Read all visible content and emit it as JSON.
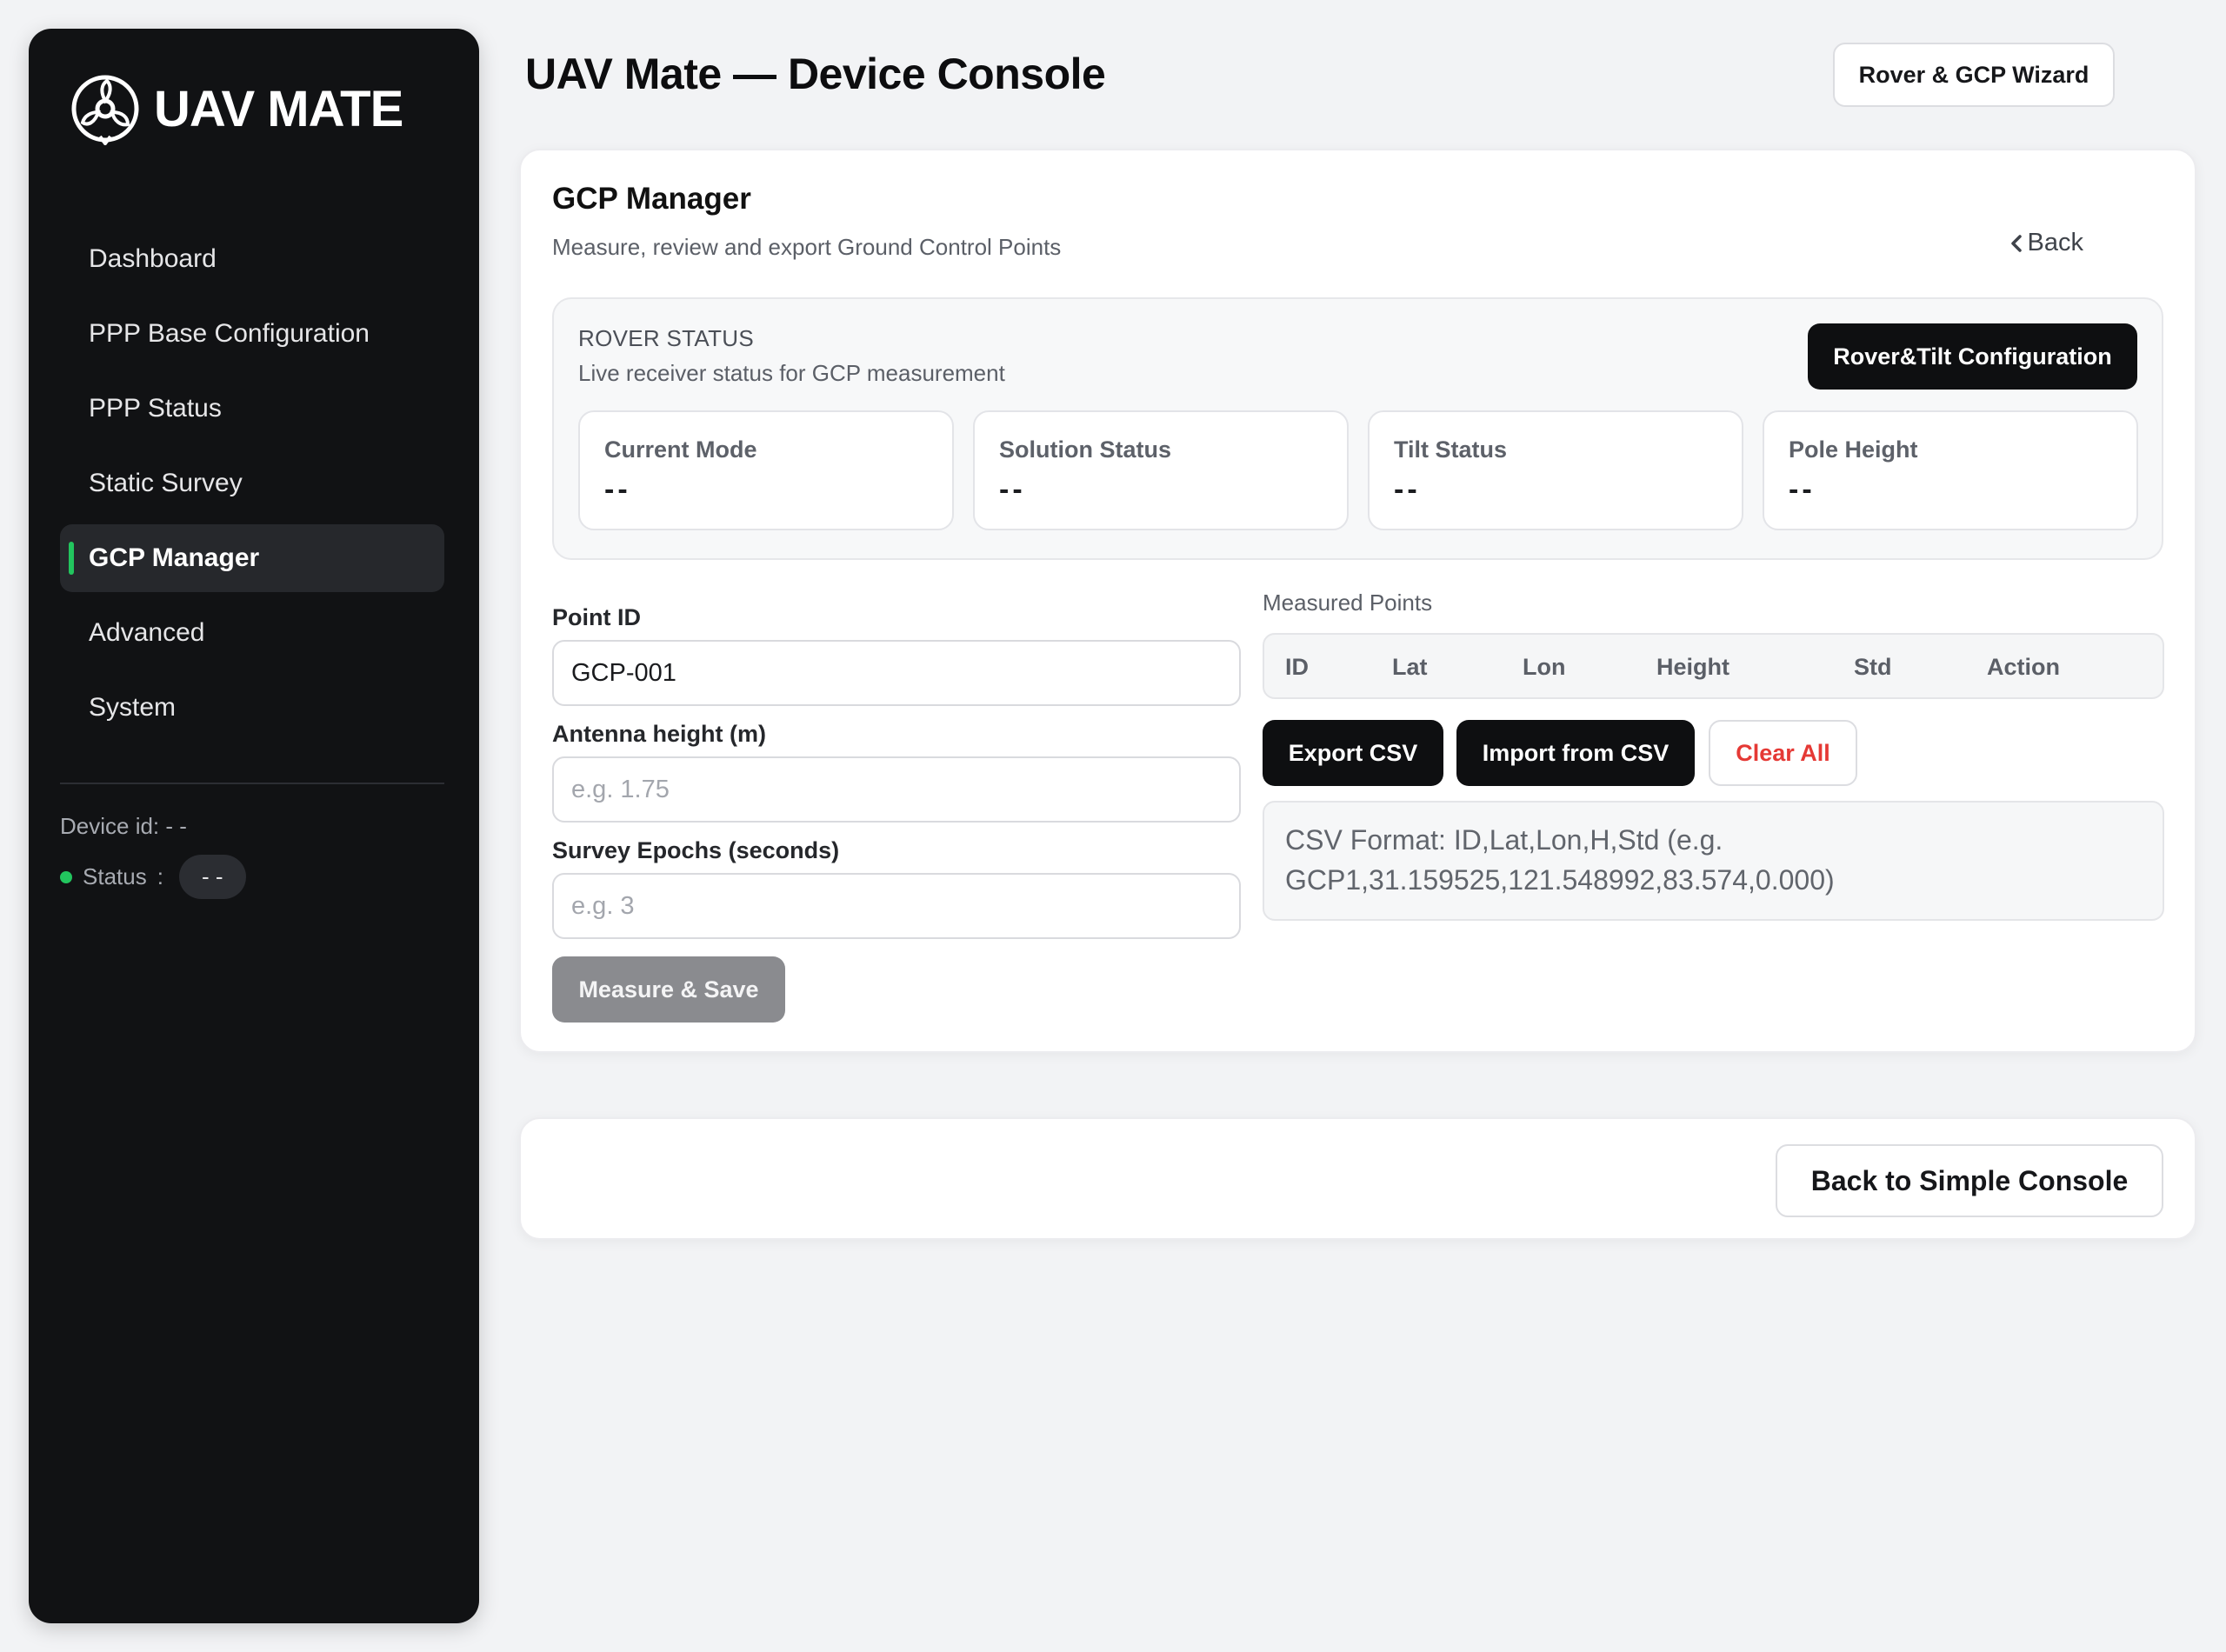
{
  "sidebar": {
    "brand": "UAV MATE",
    "items": [
      {
        "label": "Dashboard"
      },
      {
        "label": "PPP Base Configuration"
      },
      {
        "label": "PPP Status"
      },
      {
        "label": "Static Survey"
      },
      {
        "label": "GCP Manager",
        "active": true
      },
      {
        "label": "Advanced"
      },
      {
        "label": "System"
      }
    ],
    "device_id": "Device id: - -",
    "status_label": "Status",
    "status_sep": ":",
    "status_value": "- -"
  },
  "header": {
    "title": "UAV Mate — Device Console",
    "wizard_button": "Rover & GCP Wizard"
  },
  "gcp": {
    "title": "GCP Manager",
    "subtitle": "Measure, review and export Ground Control Points",
    "back": "Back",
    "rover": {
      "heading": "ROVER STATUS",
      "subheading": "Live receiver status for GCP measurement",
      "config_button": "Rover&Tilt Configuration",
      "cards": [
        {
          "label": "Current Mode",
          "value": "--"
        },
        {
          "label": "Solution Status",
          "value": "--"
        },
        {
          "label": "Tilt Status",
          "value": "--"
        },
        {
          "label": "Pole Height",
          "value": "--"
        }
      ]
    },
    "form": {
      "point_id_label": "Point ID",
      "point_id_value": "GCP-001",
      "antenna_label": "Antenna height (m)",
      "antenna_placeholder": "e.g. 1.75",
      "epochs_label": "Survey Epochs (seconds)",
      "epochs_placeholder": "e.g. 3",
      "measure_button": "Measure & Save"
    },
    "measured": {
      "title": "Measured Points",
      "columns": [
        "ID",
        "Lat",
        "Lon",
        "Height",
        "Std",
        "Action"
      ],
      "export_button": "Export CSV",
      "import_button": "Import from CSV",
      "clear_button": "Clear All",
      "csv_hint": "CSV Format: ID,Lat,Lon,H,Std (e.g. GCP1,31.159525,121.548992,83.574,0.000)"
    }
  },
  "footer": {
    "simple_console_button": "Back to Simple Console"
  },
  "colors": {
    "accent_green": "#22c55e",
    "danger_red": "#e53935",
    "sidebar_bg": "#111214"
  }
}
